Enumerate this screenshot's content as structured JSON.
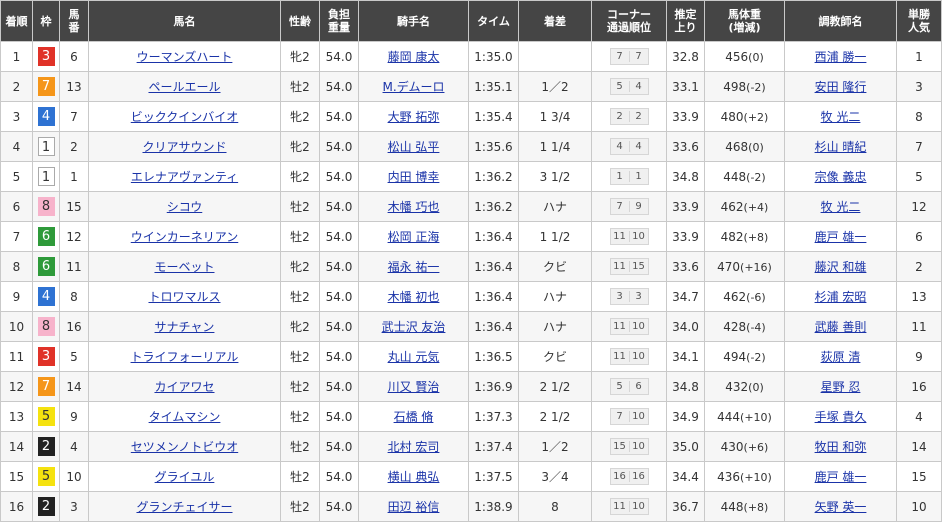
{
  "headers": {
    "rank": "着順",
    "waku": "枠",
    "num_l1": "馬",
    "num_l2": "番",
    "name": "馬名",
    "sexage": "性齢",
    "weight_l1": "負担",
    "weight_l2": "重量",
    "jockey": "騎手名",
    "time": "タイム",
    "margin": "着差",
    "corner_l1": "コーナー",
    "corner_l2": "通過順位",
    "last3f_l1": "推定",
    "last3f_l2": "上り",
    "body_l1": "馬体重",
    "body_l2": "(増減)",
    "trainer": "調教師名",
    "pop_l1": "単勝",
    "pop_l2": "人気"
  },
  "rows": [
    {
      "rank": "1",
      "waku": "3",
      "num": "6",
      "name": "ウーマンズハート",
      "sexage": "牝2",
      "weight": "54.0",
      "jockey": "藤岡 康太",
      "time": "1:35.0",
      "margin": "",
      "c1": "7",
      "c2": "7",
      "last3f": "32.8",
      "body": "456",
      "diff": "(0)",
      "trainer": "西浦 勝一",
      "pop": "1"
    },
    {
      "rank": "2",
      "waku": "7",
      "num": "13",
      "name": "ペールエール",
      "sexage": "牡2",
      "weight": "54.0",
      "jockey": "M.デムーロ",
      "time": "1:35.1",
      "margin": "1／2",
      "c1": "5",
      "c2": "4",
      "last3f": "33.1",
      "body": "498",
      "diff": "(-2)",
      "trainer": "安田 隆行",
      "pop": "3"
    },
    {
      "rank": "3",
      "waku": "4",
      "num": "7",
      "name": "ビッククインバイオ",
      "sexage": "牝2",
      "weight": "54.0",
      "jockey": "大野 拓弥",
      "time": "1:35.4",
      "margin": "1 3/4",
      "c1": "2",
      "c2": "2",
      "last3f": "33.9",
      "body": "480",
      "diff": "(+2)",
      "trainer": "牧 光二",
      "pop": "8"
    },
    {
      "rank": "4",
      "waku": "1",
      "num": "2",
      "name": "クリアサウンド",
      "sexage": "牝2",
      "weight": "54.0",
      "jockey": "松山 弘平",
      "time": "1:35.6",
      "margin": "1 1/4",
      "c1": "4",
      "c2": "4",
      "last3f": "33.6",
      "body": "468",
      "diff": "(0)",
      "trainer": "杉山 晴紀",
      "pop": "7"
    },
    {
      "rank": "5",
      "waku": "1",
      "num": "1",
      "name": "エレナアヴァンティ",
      "sexage": "牝2",
      "weight": "54.0",
      "jockey": "内田 博幸",
      "time": "1:36.2",
      "margin": "3 1/2",
      "c1": "1",
      "c2": "1",
      "last3f": "34.8",
      "body": "448",
      "diff": "(-2)",
      "trainer": "宗像 義忠",
      "pop": "5"
    },
    {
      "rank": "6",
      "waku": "8",
      "num": "15",
      "name": "シコウ",
      "sexage": "牡2",
      "weight": "54.0",
      "jockey": "木幡 巧也",
      "time": "1:36.2",
      "margin": "ハナ",
      "c1": "7",
      "c2": "9",
      "last3f": "33.9",
      "body": "462",
      "diff": "(+4)",
      "trainer": "牧 光二",
      "pop": "12"
    },
    {
      "rank": "7",
      "waku": "6",
      "num": "12",
      "name": "ウインカーネリアン",
      "sexage": "牡2",
      "weight": "54.0",
      "jockey": "松岡 正海",
      "time": "1:36.4",
      "margin": "1 1/2",
      "c1": "11",
      "c2": "10",
      "last3f": "33.9",
      "body": "482",
      "diff": "(+8)",
      "trainer": "鹿戸 雄一",
      "pop": "6"
    },
    {
      "rank": "8",
      "waku": "6",
      "num": "11",
      "name": "モーベット",
      "sexage": "牝2",
      "weight": "54.0",
      "jockey": "福永 祐一",
      "time": "1:36.4",
      "margin": "クビ",
      "c1": "11",
      "c2": "15",
      "last3f": "33.6",
      "body": "470",
      "diff": "(+16)",
      "trainer": "藤沢 和雄",
      "pop": "2"
    },
    {
      "rank": "9",
      "waku": "4",
      "num": "8",
      "name": "トロワマルス",
      "sexage": "牡2",
      "weight": "54.0",
      "jockey": "木幡 初也",
      "time": "1:36.4",
      "margin": "ハナ",
      "c1": "3",
      "c2": "3",
      "last3f": "34.7",
      "body": "462",
      "diff": "(-6)",
      "trainer": "杉浦 宏昭",
      "pop": "13"
    },
    {
      "rank": "10",
      "waku": "8",
      "num": "16",
      "name": "サナチャン",
      "sexage": "牝2",
      "weight": "54.0",
      "jockey": "武士沢 友治",
      "time": "1:36.4",
      "margin": "ハナ",
      "c1": "11",
      "c2": "10",
      "last3f": "34.0",
      "body": "428",
      "diff": "(-4)",
      "trainer": "武藤 善則",
      "pop": "11"
    },
    {
      "rank": "11",
      "waku": "3",
      "num": "5",
      "name": "トライフォーリアル",
      "sexage": "牡2",
      "weight": "54.0",
      "jockey": "丸山 元気",
      "time": "1:36.5",
      "margin": "クビ",
      "c1": "11",
      "c2": "10",
      "last3f": "34.1",
      "body": "494",
      "diff": "(-2)",
      "trainer": "荻原 清",
      "pop": "9"
    },
    {
      "rank": "12",
      "waku": "7",
      "num": "14",
      "name": "カイアワセ",
      "sexage": "牡2",
      "weight": "54.0",
      "jockey": "川又 賢治",
      "time": "1:36.9",
      "margin": "2 1/2",
      "c1": "5",
      "c2": "6",
      "last3f": "34.8",
      "body": "432",
      "diff": "(0)",
      "trainer": "星野 忍",
      "pop": "16"
    },
    {
      "rank": "13",
      "waku": "5",
      "num": "9",
      "name": "タイムマシン",
      "sexage": "牡2",
      "weight": "54.0",
      "jockey": "石橋 脩",
      "time": "1:37.3",
      "margin": "2 1/2",
      "c1": "7",
      "c2": "10",
      "last3f": "34.9",
      "body": "444",
      "diff": "(+10)",
      "trainer": "手塚 貴久",
      "pop": "4"
    },
    {
      "rank": "14",
      "waku": "2",
      "num": "4",
      "name": "セツメンノトビウオ",
      "sexage": "牡2",
      "weight": "54.0",
      "jockey": "北村 宏司",
      "time": "1:37.4",
      "margin": "1／2",
      "c1": "15",
      "c2": "10",
      "last3f": "35.0",
      "body": "430",
      "diff": "(+6)",
      "trainer": "牧田 和弥",
      "pop": "14"
    },
    {
      "rank": "15",
      "waku": "5",
      "num": "10",
      "name": "グライユル",
      "sexage": "牡2",
      "weight": "54.0",
      "jockey": "横山 典弘",
      "time": "1:37.5",
      "margin": "3／4",
      "c1": "16",
      "c2": "16",
      "last3f": "34.4",
      "body": "436",
      "diff": "(+10)",
      "trainer": "鹿戸 雄一",
      "pop": "15"
    },
    {
      "rank": "16",
      "waku": "2",
      "num": "3",
      "name": "グランチェイサー",
      "sexage": "牡2",
      "weight": "54.0",
      "jockey": "田辺 裕信",
      "time": "1:38.9",
      "margin": "8",
      "c1": "11",
      "c2": "10",
      "last3f": "36.7",
      "body": "448",
      "diff": "(+8)",
      "trainer": "矢野 英一",
      "pop": "10"
    }
  ]
}
